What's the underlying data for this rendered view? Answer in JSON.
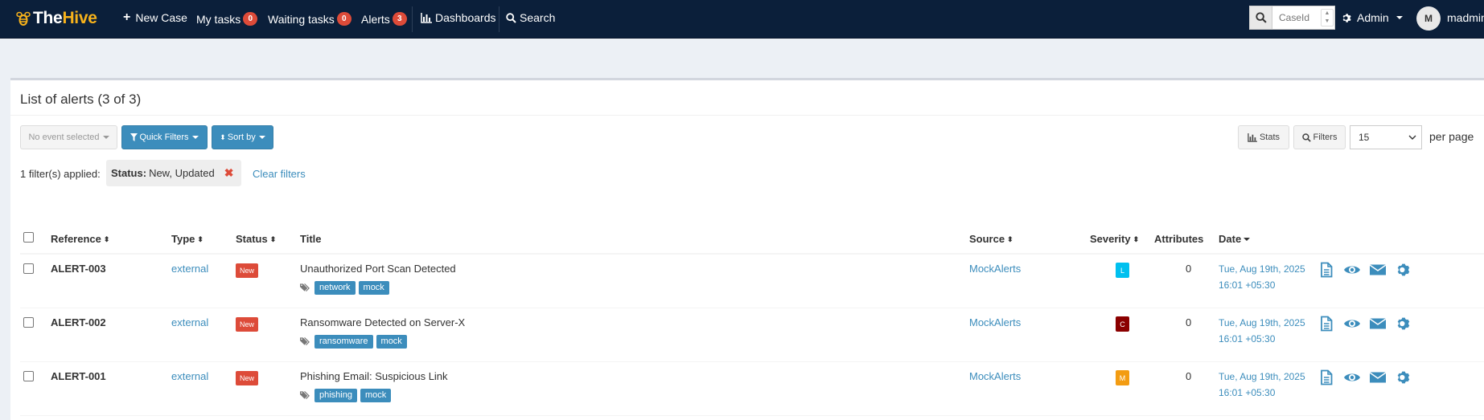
{
  "navbar": {
    "brand_the": "The",
    "brand_hive": "Hive",
    "new_case": "New Case",
    "my_tasks": "My tasks",
    "my_tasks_count": "0",
    "waiting_tasks": "Waiting tasks",
    "waiting_tasks_count": "0",
    "alerts": "Alerts",
    "alerts_count": "3",
    "dashboards": "Dashboards",
    "search": "Search",
    "caseid_placeholder": "CaseId",
    "admin": "Admin",
    "avatar_initial": "M",
    "username": "madmin"
  },
  "box": {
    "title": "List of alerts (3 of 3)",
    "no_event_selected": "No event selected",
    "quick_filters": "Quick Filters",
    "sort_by": "Sort by",
    "stats": "Stats",
    "filters": "Filters",
    "per_page_value": "15",
    "per_page_label": "per page",
    "filters_applied": "1 filter(s) applied:",
    "filter_key": "Status:",
    "filter_value": "New, Updated",
    "clear_filters": "Clear filters"
  },
  "table": {
    "headers": {
      "reference": "Reference",
      "type": "Type",
      "status": "Status",
      "title": "Title",
      "source": "Source",
      "severity": "Severity",
      "attributes": "Attributes",
      "date": "Date"
    },
    "rows": [
      {
        "reference": "ALERT-003",
        "type": "external",
        "status": "New",
        "title": "Unauthorized Port Scan Detected",
        "tags": [
          "network",
          "mock"
        ],
        "source": "MockAlerts",
        "severity": "L",
        "severity_color": "#00c0ef",
        "attributes": "0",
        "date_line1": "Tue, Aug 19th, 2025",
        "date_line2": "16:01 +05:30"
      },
      {
        "reference": "ALERT-002",
        "type": "external",
        "status": "New",
        "title": "Ransomware Detected on Server-X",
        "tags": [
          "ransomware",
          "mock"
        ],
        "source": "MockAlerts",
        "severity": "C",
        "severity_color": "#8b0000",
        "attributes": "0",
        "date_line1": "Tue, Aug 19th, 2025",
        "date_line2": "16:01 +05:30"
      },
      {
        "reference": "ALERT-001",
        "type": "external",
        "status": "New",
        "title": "Phishing Email: Suspicious Link",
        "tags": [
          "phishing",
          "mock"
        ],
        "source": "MockAlerts",
        "severity": "M",
        "severity_color": "#f39c12",
        "attributes": "0",
        "date_line1": "Tue, Aug 19th, 2025",
        "date_line2": "16:01 +05:30"
      }
    ]
  },
  "colors": {
    "navbar_bg": "#0b1f3a",
    "accent": "#3c8dbc",
    "badge_red": "#dd4b39",
    "brand_yellow": "#f7b21b"
  },
  "icons": [
    "bee-logo-icon",
    "plus-icon",
    "bar-chart-icon",
    "search-icon",
    "gear-icon",
    "caret-down-icon",
    "filter-icon",
    "sort-icon",
    "tags-icon",
    "file-icon",
    "eye-icon",
    "envelope-icon",
    "remove-icon"
  ]
}
